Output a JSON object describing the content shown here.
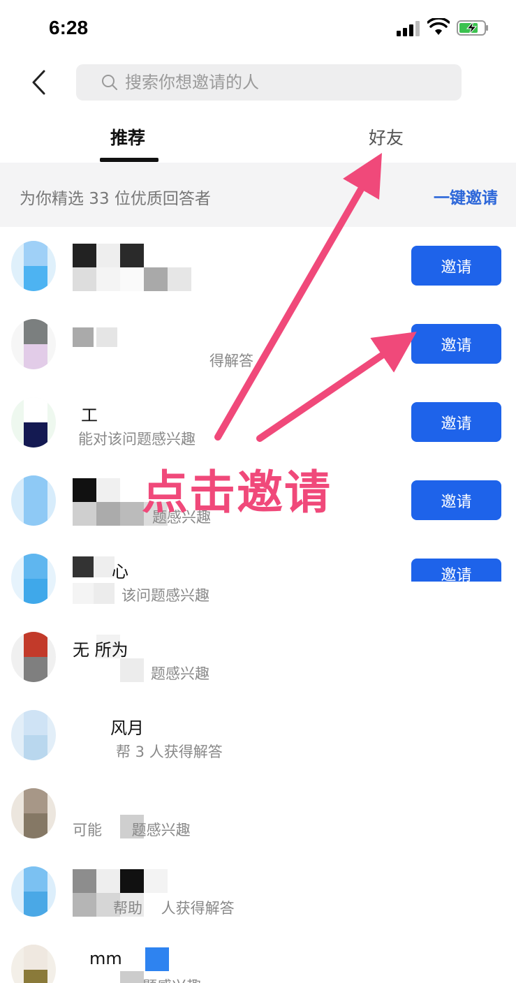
{
  "status_bar": {
    "time": "6:28"
  },
  "search": {
    "placeholder": "搜索你想邀请的人"
  },
  "tabs": [
    {
      "label": "推荐",
      "active": true
    },
    {
      "label": "好友",
      "active": false
    }
  ],
  "banner": {
    "text": "为你精选 33 位优质回答者",
    "action": "一键邀请"
  },
  "list": [
    {
      "name": "",
      "desc": "",
      "button": "邀请",
      "avatar_colors": [
        "#9fd0f7",
        "#4db3f2"
      ]
    },
    {
      "name": "",
      "desc": "得解答",
      "button": "邀请",
      "avatar_colors": [
        "#7b7f7f",
        "#e2cce8"
      ]
    },
    {
      "name": "工",
      "desc": "能对该问题感兴趣",
      "button": "邀请",
      "avatar_colors": [
        "#ffffff",
        "#141a52"
      ]
    },
    {
      "name": "",
      "desc": "题感兴趣",
      "button": "邀请",
      "avatar_colors": [
        "#8ec9f5",
        "#8ec9f5"
      ]
    },
    {
      "name": "心",
      "desc": "该问题感兴趣",
      "button": "邀请",
      "avatar_colors": [
        "#5fb6ef",
        "#3fa8ea"
      ]
    },
    {
      "name": "无 所为",
      "desc": "题感兴趣",
      "button": "",
      "avatar_colors": [
        "#c23a2a",
        "#7f7f7f"
      ]
    },
    {
      "name": "风月",
      "desc": "帮 3 人获得解答",
      "button": "",
      "avatar_colors": [
        "#cfe3f5",
        "#b9d7ee"
      ]
    },
    {
      "name": "",
      "desc": "可能 题感兴趣",
      "button": "",
      "avatar_colors": [
        "#a79787",
        "#857865"
      ]
    },
    {
      "name": "",
      "desc": "帮助 人获得解答",
      "button": "",
      "avatar_colors": [
        "#7bc1f2",
        "#4aa8e6"
      ]
    },
    {
      "name": "mm",
      "desc": "题感兴趣",
      "button": "",
      "avatar_colors": [
        "#efe8e0",
        "#8a7a3a"
      ]
    }
  ],
  "annotation": {
    "label": "点击邀请",
    "color": "#f0497a"
  },
  "colors": {
    "accent": "#1e63ea",
    "link": "#2d67d9",
    "banner_bg": "#f4f4f5"
  }
}
